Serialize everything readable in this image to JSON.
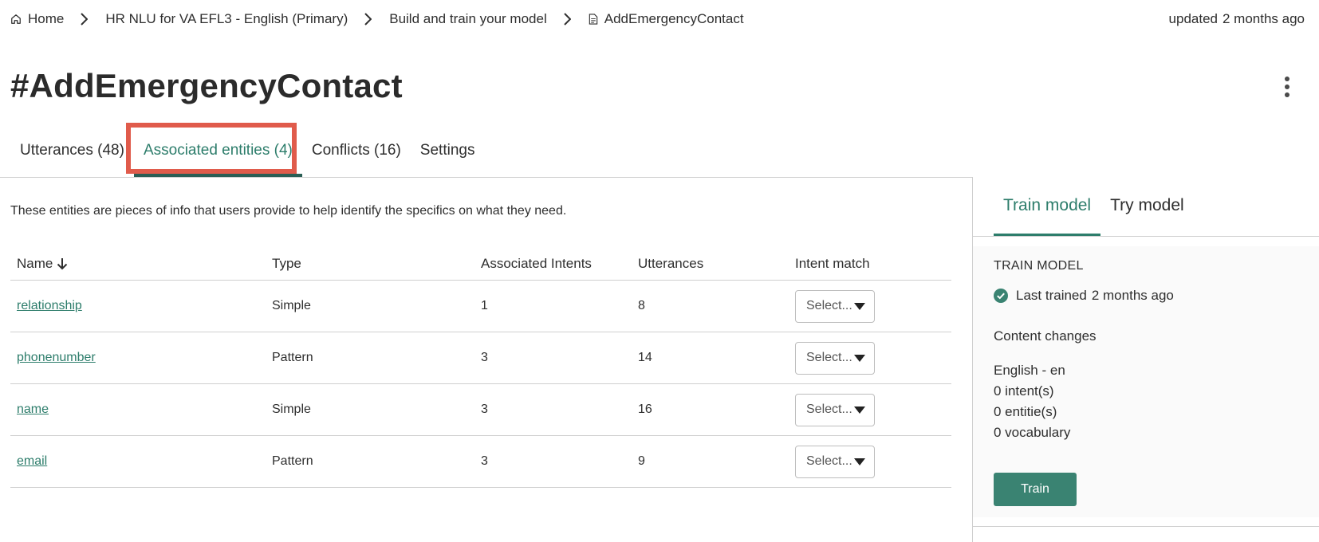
{
  "breadcrumb": {
    "home": "Home",
    "items": [
      "HR NLU for VA EFL3 - English (Primary)",
      "Build and train your model",
      "AddEmergencyContact"
    ]
  },
  "updated": {
    "label": "updated",
    "value": "2 months ago"
  },
  "page_title": "#AddEmergencyContact",
  "tabs": [
    {
      "label": "Utterances (48)"
    },
    {
      "label": "Associated entities (4)",
      "active": true
    },
    {
      "label": "Conflicts (16)"
    },
    {
      "label": "Settings"
    }
  ],
  "description": "These entities are pieces of info that users provide to help identify the specifics on what they need.",
  "table": {
    "headers": [
      "Name",
      "Type",
      "Associated Intents",
      "Utterances",
      "Intent match"
    ],
    "rows": [
      {
        "name": "relationship",
        "type": "Simple",
        "intents": "1",
        "utterances": "8",
        "match": "Select..."
      },
      {
        "name": "phonenumber",
        "type": "Pattern",
        "intents": "3",
        "utterances": "14",
        "match": "Select..."
      },
      {
        "name": "name",
        "type": "Simple",
        "intents": "3",
        "utterances": "16",
        "match": "Select..."
      },
      {
        "name": "email",
        "type": "Pattern",
        "intents": "3",
        "utterances": "9",
        "match": "Select..."
      }
    ]
  },
  "right_panel": {
    "tabs": [
      {
        "label": "Train model",
        "active": true
      },
      {
        "label": "Try model"
      }
    ],
    "heading": "TRAIN MODEL",
    "status_label": "Last trained",
    "status_value": "2 months ago",
    "content_changes": "Content changes",
    "changes": [
      "English - en",
      "0 intent(s)",
      "0 entitie(s)",
      "0 vocabulary"
    ],
    "train_button": "Train"
  },
  "colors": {
    "accent": "#2d7d6b",
    "highlight": "#e05b4b",
    "button": "#3a8372"
  },
  "icons": [
    "home-icon",
    "chevron-right-icon",
    "document-icon",
    "overflow-menu-icon",
    "arrow-down-icon",
    "caret-down-icon",
    "check-circle-icon"
  ]
}
